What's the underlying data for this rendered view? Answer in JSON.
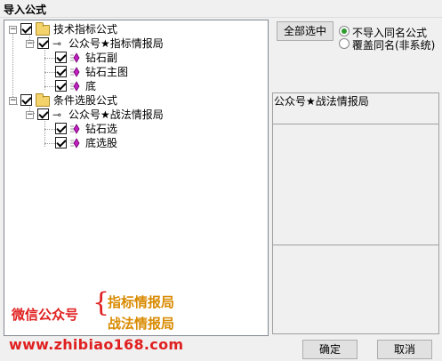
{
  "window": {
    "title": "导入公式"
  },
  "tree": {
    "nodes": [
      {
        "label": "技术指标公式"
      },
      {
        "label": "公众号★指标情报局"
      },
      {
        "label": "钻石副"
      },
      {
        "label": "钻石主图"
      },
      {
        "label": "底"
      },
      {
        "label": "条件选股公式"
      },
      {
        "label": "公众号★战法情报局"
      },
      {
        "label": "钻石选"
      },
      {
        "label": "底选股"
      }
    ]
  },
  "options": {
    "select_all_label": "全部选中",
    "no_import_label": "不导入同名公式",
    "overwrite_label": "覆盖同名(非系统)",
    "selected": "no_import"
  },
  "info": {
    "text": "公众号★战法情报局"
  },
  "watermark": {
    "line1": "微信公众号",
    "brace": "{",
    "item1": "指标情报局",
    "item2": "战法情报局",
    "url": "www.zhibiao168.com"
  },
  "buttons": {
    "ok": "确定",
    "cancel": "取消"
  },
  "colors": {
    "watermark_red": "#e02020",
    "watermark_orange": "#d98a00",
    "radio_green": "#2f9a2f"
  }
}
